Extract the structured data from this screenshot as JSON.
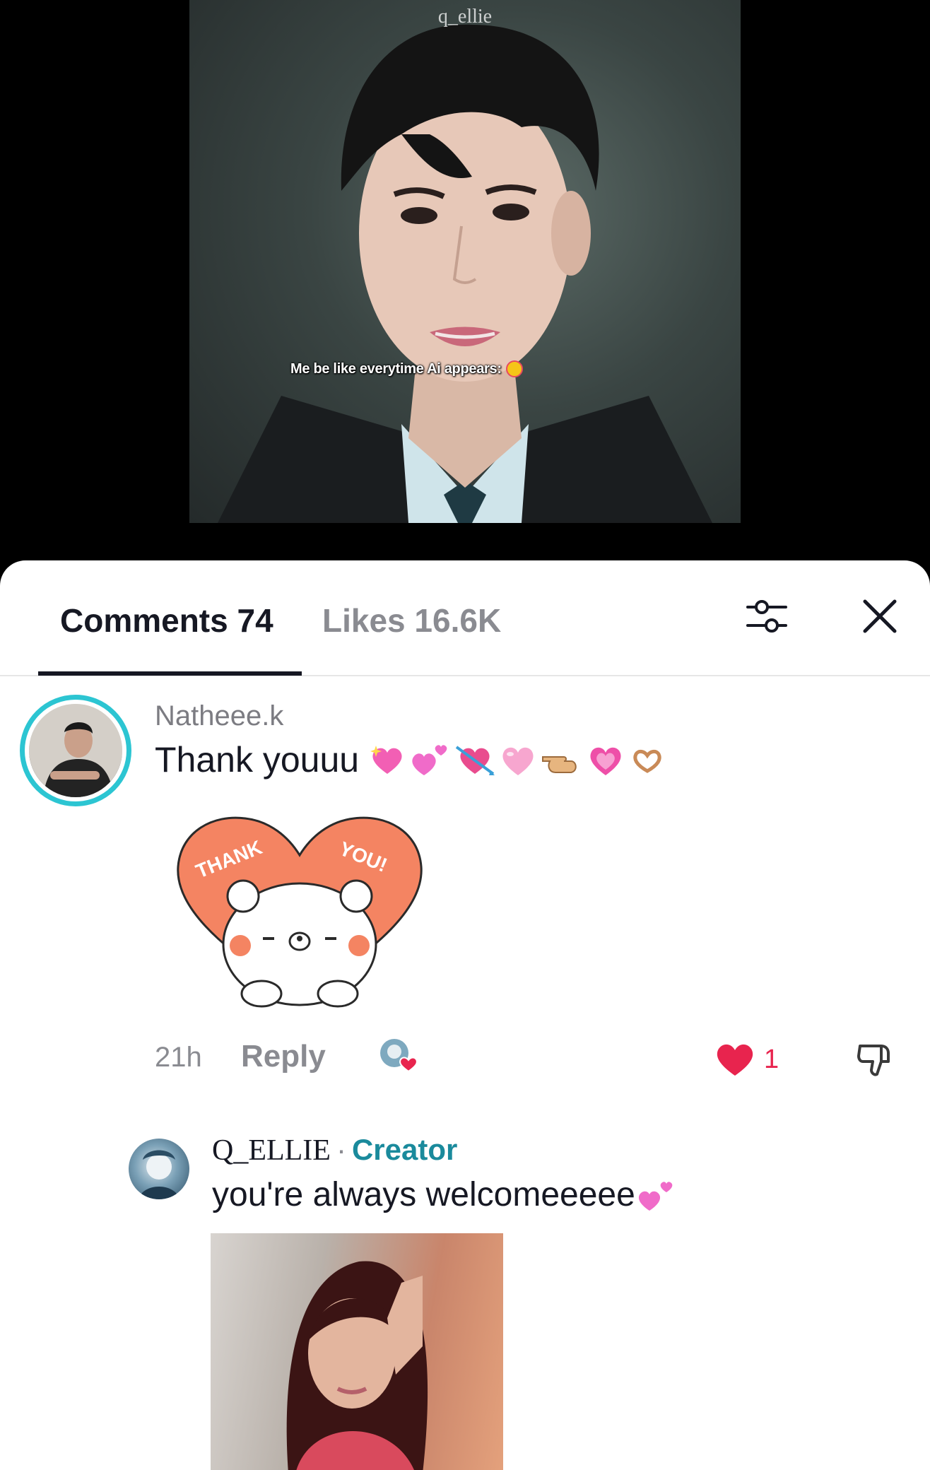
{
  "video": {
    "watermark": "q_ellie",
    "caption": "Me be like everytime Ai appears:",
    "caption_emoji": "heart-eyes-emoji"
  },
  "tabs": {
    "comments_label": "Comments 74",
    "likes_label": "Likes 16.6K",
    "active": "comments"
  },
  "icons": {
    "filter": "sliders-icon",
    "close": "close-icon"
  },
  "comment": {
    "username": "Natheee.k",
    "text": "Thank youuu",
    "emojis": [
      "sparkling-heart",
      "two-hearts",
      "heart-with-arrow",
      "pink-heart",
      "pointing-hand",
      "growing-heart",
      "heart-hands"
    ],
    "sticker": {
      "text_left": "THANK",
      "text_right": "YOU!"
    },
    "time": "21h",
    "reply_label": "Reply",
    "like_count": "1",
    "liked": true
  },
  "reply": {
    "username": "Q_ELLIE",
    "separator": "·",
    "badge": "Creator",
    "text": "you're always welcomeeeee"
  },
  "colors": {
    "accent_like": "#e8244e",
    "creator_badge": "#1a8a9c",
    "avatar_ring": "#2cc5d2",
    "sticker_heart": "#f48462"
  }
}
